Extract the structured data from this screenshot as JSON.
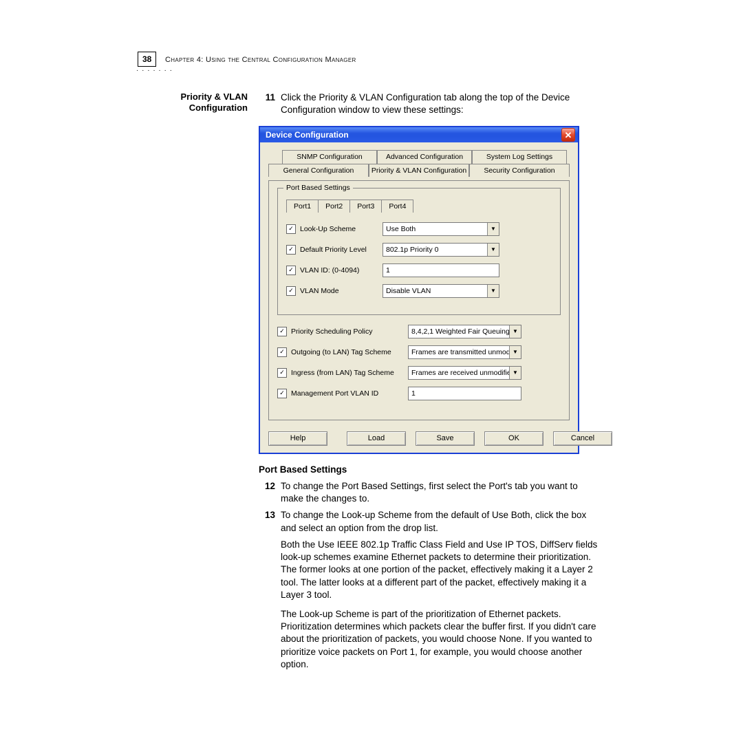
{
  "page_number": "38",
  "chapter_line": "Chapter 4: Using the Central Configuration Manager",
  "margin_heading": "Priority & VLAN Configuration",
  "step11_num": "11",
  "step11_text": "Click the Priority & VLAN Configuration tab along the top of the Device Configuration window to view these settings:",
  "dialog": {
    "title": "Device Configuration",
    "close_glyph": "✕",
    "tabs_top": [
      "SNMP Configuration",
      "Advanced Configuration",
      "System Log Settings"
    ],
    "tabs_bottom": [
      "General Configuration",
      "Priority & VLAN Configuration",
      "Security Configuration"
    ],
    "fieldset_legend": "Port Based Settings",
    "port_tabs": [
      "Port1",
      "Port2",
      "Port3",
      "Port4"
    ],
    "rows": {
      "lookup_label": "Look-Up Scheme",
      "lookup_value": "Use Both",
      "priority_label": "Default Priority Level",
      "priority_value": "802.1p Priority 0",
      "vlanid_label": "VLAN ID: (0-4094)",
      "vlanid_value": "1",
      "vlanmode_label": "VLAN Mode",
      "vlanmode_value": "Disable VLAN"
    },
    "lower": {
      "sched_label": "Priority Scheduling Policy",
      "sched_value": "8,4,2,1 Weighted Fair Queuing",
      "out_label": "Outgoing (to LAN) Tag Scheme",
      "out_value": "Frames are transmitted unmodi",
      "in_label": "Ingress (from LAN) Tag Scheme",
      "in_value": "Frames are received unmodifie",
      "mgmt_label": "Management Port VLAN ID",
      "mgmt_value": "1"
    },
    "buttons": {
      "help": "Help",
      "load": "Load",
      "save": "Save",
      "ok": "OK",
      "cancel": "Cancel"
    }
  },
  "port_heading": "Port Based Settings",
  "step12_num": "12",
  "step12_text": "To change the Port Based Settings, first select the Port's tab you want to make the changes to.",
  "step13_num": "13",
  "step13_text": "To change the Look-up Scheme from the default of Use Both, click the box and select an option from the drop list.",
  "para1": "Both the Use IEEE 802.1p Traffic Class Field and Use IP TOS, DiffServ fields look-up schemes examine Ethernet packets to determine their prioritization. The former looks at one portion of the packet, effectively making it a Layer 2 tool. The latter looks at a different part of the packet, effectively making it a Layer 3 tool.",
  "para2": "The Look-up Scheme is part of the prioritization of Ethernet packets. Prioritization determines which packets clear the buffer first. If you didn't care about the prioritization of packets, you would choose None. If you wanted to prioritize voice packets on Port 1, for example, you would choose another option."
}
